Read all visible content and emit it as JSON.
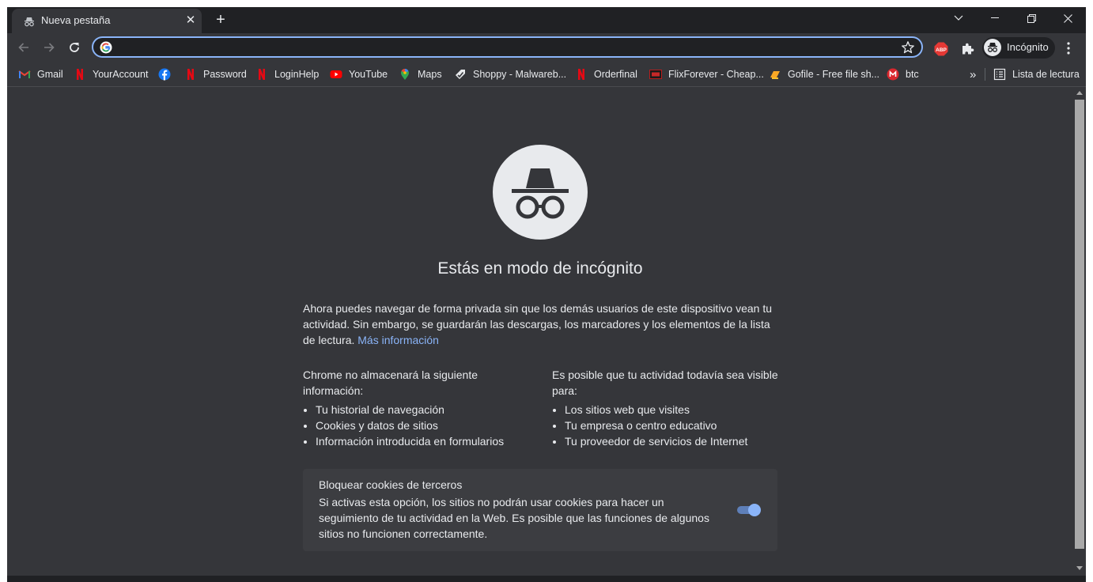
{
  "tab": {
    "title": "Nueva pestaña",
    "close": "✕"
  },
  "newtab_label": "+",
  "window_controls": {
    "dropdown": "tab-search",
    "minimize": "minimize",
    "restore": "restore",
    "close": "close"
  },
  "toolbar": {
    "omnibox": {
      "value": "",
      "placeholder": ""
    },
    "abp_label": "ABP",
    "profile_label": "Incógnito"
  },
  "bookmarks": [
    {
      "label": "Gmail",
      "icon": "gmail-icon"
    },
    {
      "label": "YourAccount",
      "icon": "netflix-icon"
    },
    {
      "label": "",
      "icon": "facebook-icon"
    },
    {
      "label": "Password",
      "icon": "netflix-icon"
    },
    {
      "label": "LoginHelp",
      "icon": "netflix-icon"
    },
    {
      "label": "YouTube",
      "icon": "youtube-icon"
    },
    {
      "label": "Maps",
      "icon": "maps-icon"
    },
    {
      "label": "Shoppy - Malwareb...",
      "icon": "shoppy-icon"
    },
    {
      "label": "Orderfinal",
      "icon": "netflix-icon"
    },
    {
      "label": "FlixForever - Cheap...",
      "icon": "flixforever-icon"
    },
    {
      "label": "Gofile - Free file sh...",
      "icon": "gofile-icon"
    },
    {
      "label": "btc",
      "icon": "mega-icon"
    }
  ],
  "bookmarks_overflow": "»",
  "reading_list_label": "Lista de lectura",
  "content": {
    "heading": "Estás en modo de incógnito",
    "intro": "Ahora puedes navegar de forma privada sin que los demás usuarios de este dispositivo vean tu actividad. Sin embargo, se guardarán las descargas, los marcadores y los elementos de la lista de lectura.",
    "learn_more": "Más información",
    "left_title": "Chrome no almacenará la siguiente información:",
    "left_items": [
      "Tu historial de navegación",
      "Cookies y datos de sitios",
      "Información introducida en formularios"
    ],
    "right_title": "Es posible que tu actividad todavía sea visible para:",
    "right_items": [
      "Los sitios web que visites",
      "Tu empresa o centro educativo",
      "Tu proveedor de servicios de Internet"
    ],
    "cookies": {
      "title": "Bloquear cookies de terceros",
      "description": "Si activas esta opción, los sitios no podrán usar cookies para hacer un seguimiento de tu actividad en la Web. Es posible que las funciones de algunos sitios no funcionen correctamente.",
      "enabled": true
    }
  },
  "colors": {
    "frame": "#202124",
    "toolbar": "#35363a",
    "text": "#e8eaed",
    "accent": "#8ab4f8",
    "card": "#3c3d41"
  }
}
